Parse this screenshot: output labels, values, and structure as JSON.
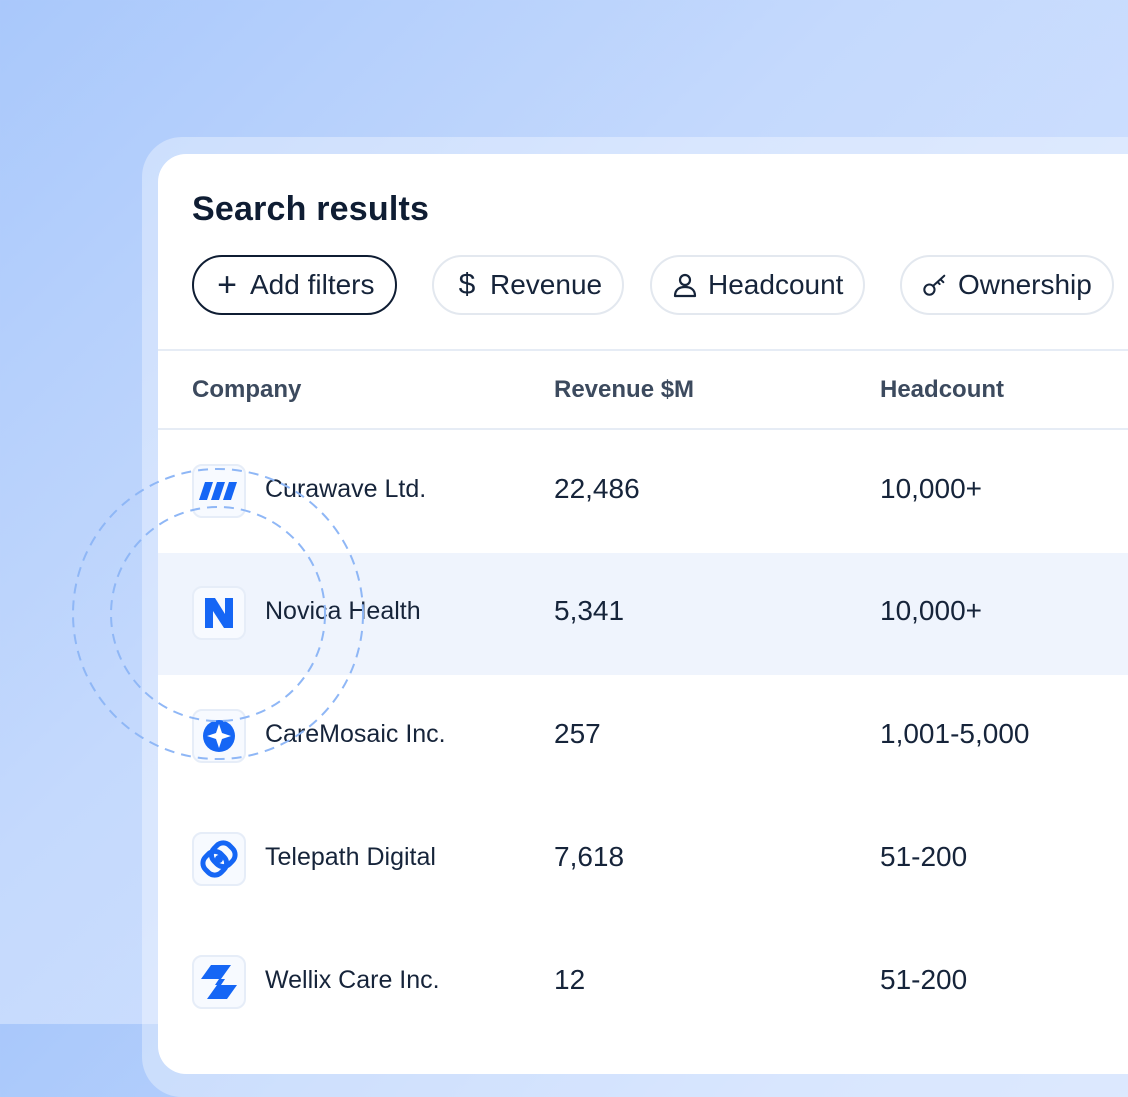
{
  "title": "Search results",
  "filters": {
    "add_label": "Add filters",
    "chips": [
      {
        "label": "Revenue",
        "icon": "dollar-icon"
      },
      {
        "label": "Headcount",
        "icon": "user-icon"
      },
      {
        "label": "Ownership",
        "icon": "key-icon"
      }
    ]
  },
  "table": {
    "columns": [
      "Company",
      "Revenue $M",
      "Headcount"
    ],
    "rows": [
      {
        "company": "Curawave Ltd.",
        "revenue": "22,486",
        "headcount": "10,000+",
        "logo": "curawave-logo"
      },
      {
        "company": "Novica Health",
        "revenue": "5,341",
        "headcount": "10,000+",
        "logo": "novica-logo"
      },
      {
        "company": "CareMosaic Inc.",
        "revenue": "257",
        "headcount": "1,001-5,000",
        "logo": "caremosaic-logo"
      },
      {
        "company": "Telepath Digital",
        "revenue": "7,618",
        "headcount": "51-200",
        "logo": "telepath-logo"
      },
      {
        "company": "Wellix Care Inc.",
        "revenue": "12",
        "headcount": "51-200",
        "logo": "wellix-logo"
      }
    ]
  },
  "colors": {
    "accent": "#1566f5",
    "text": "#0f1d33",
    "highlight_row": "#eff4fd"
  }
}
